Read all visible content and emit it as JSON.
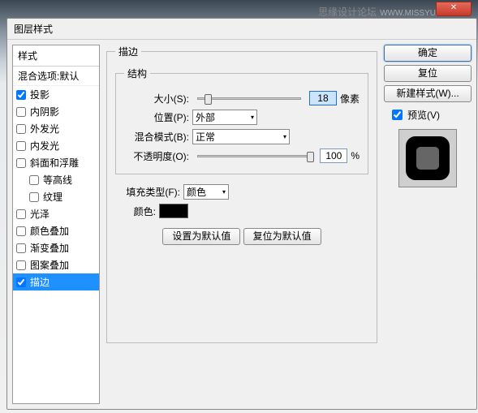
{
  "watermark": {
    "text": "思缘设计论坛",
    "site": "WWW.MISSYUAN.COM"
  },
  "closeGlyph": "✕",
  "dialogTitle": "图层样式",
  "stylesHeader": "样式",
  "blendOptions": "混合选项:默认",
  "styles": [
    {
      "label": "投影",
      "checked": true
    },
    {
      "label": "内阴影",
      "checked": false
    },
    {
      "label": "外发光",
      "checked": false
    },
    {
      "label": "内发光",
      "checked": false
    },
    {
      "label": "斜面和浮雕",
      "checked": false
    },
    {
      "label": "等高线",
      "checked": false,
      "indent": true
    },
    {
      "label": "纹理",
      "checked": false,
      "indent": true
    },
    {
      "label": "光泽",
      "checked": false
    },
    {
      "label": "颜色叠加",
      "checked": false
    },
    {
      "label": "渐变叠加",
      "checked": false
    },
    {
      "label": "图案叠加",
      "checked": false
    },
    {
      "label": "描边",
      "checked": true,
      "selected": true
    }
  ],
  "panelTitle": "描边",
  "structureTitle": "结构",
  "size": {
    "label": "大小(S):",
    "value": "18",
    "unit": "像素",
    "thumbPct": 6
  },
  "position": {
    "label": "位置(P):",
    "value": "外部"
  },
  "blendMode": {
    "label": "混合模式(B):",
    "value": "正常"
  },
  "opacity": {
    "label": "不透明度(O):",
    "value": "100",
    "unit": "%",
    "thumbPct": 96
  },
  "fillType": {
    "label": "填充类型(F):",
    "value": "颜色"
  },
  "colorLabel": "颜色:",
  "colorValue": "#000000",
  "setDefault": "设置为默认值",
  "resetDefault": "复位为默认值",
  "buttons": {
    "ok": "确定",
    "cancel": "复位",
    "newStyle": "新建样式(W)..."
  },
  "preview": {
    "label": "预览(V)",
    "checked": true
  }
}
